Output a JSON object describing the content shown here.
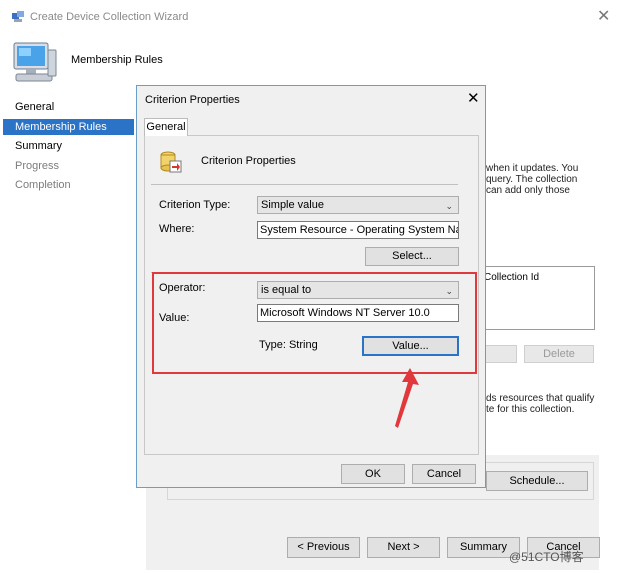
{
  "wizard": {
    "title": "Create Device Collection Wizard",
    "header": "Membership Rules",
    "nav": [
      "General",
      "Membership Rules",
      "Summary",
      "Progress",
      "Completion"
    ],
    "bg_text_1": [
      "when it updates. You",
      "query. The collection",
      "can add only those"
    ],
    "list_header": "Collection Id",
    "edit_label": "",
    "delete_label": "Delete",
    "bg_text_2": [
      "ds resources that qualify",
      "te for this collection."
    ],
    "schedule_label": "Schedule...",
    "prev_label": "< Previous",
    "next_label": "Next >",
    "summary_label": "Summary",
    "cancel_label": "Cancel"
  },
  "dialog": {
    "title": "Criterion Properties",
    "tab": "General",
    "section_title": "Criterion Properties",
    "criterion_type_label": "Criterion Type:",
    "criterion_type_value": "Simple value",
    "where_label": "Where:",
    "where_value": "System Resource - Operating System Name and",
    "select_label": "Select...",
    "operator_label": "Operator:",
    "operator_value": "is equal to",
    "value_label": "Value:",
    "value_value": "Microsoft Windows NT Server 10.0",
    "type_text": "Type: String",
    "value_button_label": "Value...",
    "ok_label": "OK",
    "cancel_label": "Cancel"
  },
  "watermark": "@51CTO博客",
  "colors": {
    "accent": "#2a73c7",
    "highlight": "#e0383d",
    "dialog_border": "#6a9ec9"
  }
}
